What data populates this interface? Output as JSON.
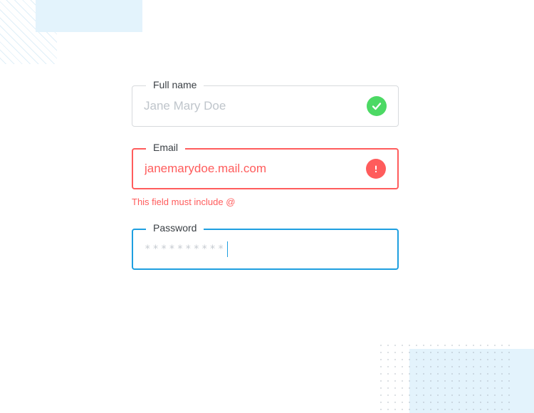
{
  "form": {
    "fullname": {
      "label": "Full name",
      "placeholder": "Jane Mary Doe",
      "value": ""
    },
    "email": {
      "label": "Email",
      "value": "janemarydoe.mail.com",
      "error_message": "This field must include @"
    },
    "password": {
      "label": "Password",
      "mask": "**********"
    }
  },
  "colors": {
    "success": "#4cd964",
    "error": "#ff5c5c",
    "focus": "#1e9fe0",
    "deco_bg": "#e3f3fc"
  }
}
